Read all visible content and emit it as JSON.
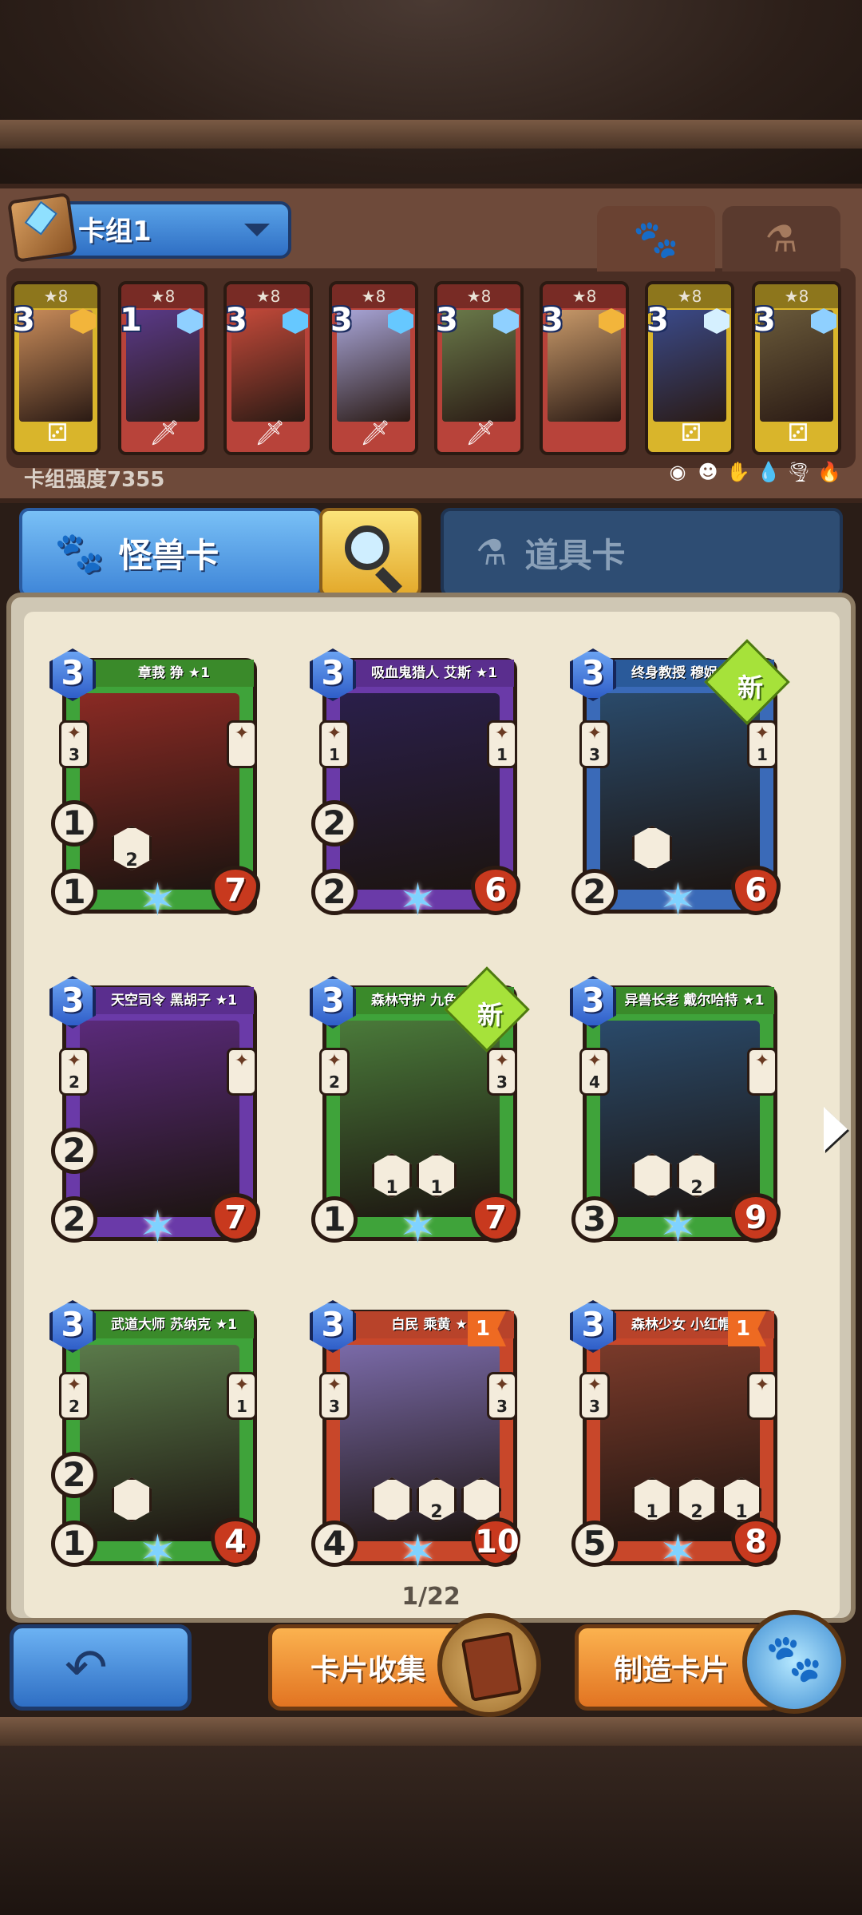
{
  "deck": {
    "name": "卡组1",
    "power_label": "卡组强度7355",
    "tabs": [
      {
        "icon": "paw-icon",
        "glyph": "🐾"
      },
      {
        "icon": "flask-icon",
        "glyph": "⚗"
      }
    ],
    "elements": [
      "◉",
      "☻",
      "✋",
      "💧",
      "🌪",
      "🔥"
    ],
    "cards": [
      {
        "cost": "3",
        "star": "★8",
        "frame": "#d9b52b",
        "art": "#c98c5a",
        "gem": "#f2b53b",
        "bottom": "⚂"
      },
      {
        "cost": "1",
        "star": "★8",
        "frame": "#b8433a",
        "art": "#5a3a8a",
        "gem": "#8fd0ff",
        "bottom": "🗡"
      },
      {
        "cost": "3",
        "star": "★8",
        "frame": "#b8433a",
        "art": "#c54a3a",
        "gem": "#66c8ff",
        "bottom": "🗡"
      },
      {
        "cost": "3",
        "star": "★8",
        "frame": "#b8433a",
        "art": "#a9a6d9",
        "gem": "#66c8ff",
        "bottom": "🗡"
      },
      {
        "cost": "3",
        "star": "★8",
        "frame": "#b8433a",
        "art": "#6a7a4a",
        "gem": "#8fd0ff",
        "bottom": "🗡"
      },
      {
        "cost": "3",
        "star": "★8",
        "frame": "#b8433a",
        "art": "#c99a6a",
        "gem": "#f2b53b",
        "bottom": ""
      },
      {
        "cost": "3",
        "star": "★8",
        "frame": "#d9b52b",
        "art": "#3a4a8a",
        "gem": "#d5f0ff",
        "bottom": "⚂"
      },
      {
        "cost": "3",
        "star": "★8",
        "frame": "#d9b52b",
        "art": "#6a5a3a",
        "gem": "#8fd0ff",
        "bottom": "⚂"
      }
    ]
  },
  "categories": {
    "monster_label": "怪兽卡",
    "monster_icon": "🐾",
    "item_label": "道具卡",
    "item_icon": "⚗"
  },
  "collection": {
    "page": "1/22",
    "cards": [
      {
        "name": "章莪 狰 ★1",
        "cost": "3",
        "dice": "1",
        "atk": "1",
        "hp": "7",
        "left": "3",
        "right": "",
        "skills": [
          "2"
        ],
        "frame": "#3fa33a",
        "art": "#8a2a24",
        "banner": "#3a8a2a",
        "new": false,
        "flag": ""
      },
      {
        "name": "吸血鬼猎人 艾斯 ★1",
        "cost": "3",
        "dice": "2",
        "atk": "2",
        "hp": "6",
        "left": "1",
        "right": "1",
        "skills": [],
        "frame": "#6a3aa8",
        "art": "#2a1f4a",
        "banner": "#5a2e8e",
        "new": false,
        "flag": ""
      },
      {
        "name": "终身教授 穆娖尔 ★1",
        "cost": "3",
        "dice": "",
        "atk": "2",
        "hp": "6",
        "left": "3",
        "right": "1",
        "skills": [
          ""
        ],
        "frame": "#3a6ab8",
        "art": "#2a4a6a",
        "banner": "#2a5a9a",
        "new": true,
        "flag": ""
      },
      {
        "name": "天空司令 黑胡子 ★1",
        "cost": "3",
        "dice": "2",
        "atk": "2",
        "hp": "7",
        "left": "2",
        "right": "",
        "skills": [],
        "frame": "#6a3aa8",
        "art": "#5a2a7a",
        "banner": "#5a2e8e",
        "new": false,
        "flag": ""
      },
      {
        "name": "森林守护 九色鹿 ★1",
        "cost": "3",
        "dice": "",
        "atk": "1",
        "hp": "7",
        "left": "2",
        "right": "3",
        "skills": [
          "1",
          "1"
        ],
        "frame": "#3fa33a",
        "art": "#4a7a3a",
        "banner": "#3a8a2a",
        "new": true,
        "flag": ""
      },
      {
        "name": "异兽长老 戴尔哈特 ★1",
        "cost": "3",
        "dice": "",
        "atk": "3",
        "hp": "9",
        "left": "4",
        "right": "",
        "skills": [
          "",
          "2"
        ],
        "frame": "#3fa33a",
        "art": "#2a4a6a",
        "banner": "#3a8a2a",
        "new": false,
        "flag": ""
      },
      {
        "name": "武道大师 苏纳克 ★1",
        "cost": "3",
        "dice": "2",
        "atk": "1",
        "hp": "4",
        "left": "2",
        "right": "1",
        "skills": [
          ""
        ],
        "frame": "#3fa33a",
        "art": "#5a7a4a",
        "banner": "#3a8a2a",
        "new": false,
        "flag": ""
      },
      {
        "name": "白民 乘黄 ★8",
        "cost": "3",
        "dice": "",
        "atk": "4",
        "hp": "10",
        "left": "3",
        "right": "3",
        "skills": [
          "",
          "2",
          ""
        ],
        "frame": "#c8472a",
        "art": "#7a6aa8",
        "banner": "#b8432a",
        "new": false,
        "flag": "1"
      },
      {
        "name": "森林少女 小红帽 ★8",
        "cost": "3",
        "dice": "",
        "atk": "5",
        "hp": "8",
        "left": "3",
        "right": "",
        "skills": [
          "1",
          "2",
          "1"
        ],
        "frame": "#c8472a",
        "art": "#7a3a2a",
        "banner": "#b8432a",
        "new": false,
        "flag": "1"
      }
    ]
  },
  "bottom": {
    "back_icon": "↶",
    "collect_label": "卡片收集",
    "craft_label": "制造卡片"
  },
  "colors": {
    "accent_blue": "#3f86d8",
    "accent_orange": "#e27422",
    "new_tag": "#a6e23a"
  }
}
